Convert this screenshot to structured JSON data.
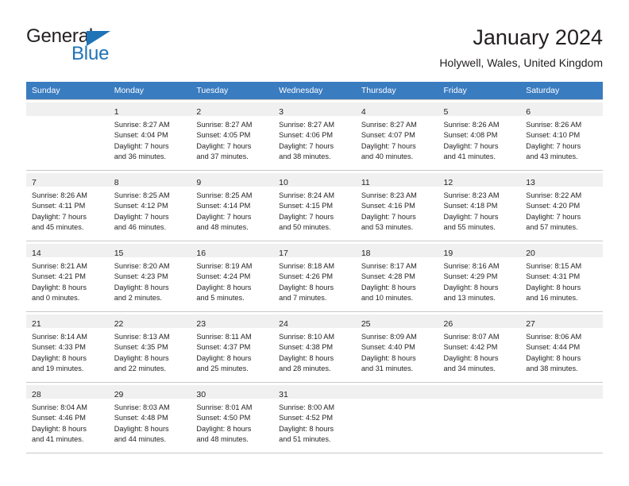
{
  "logo": {
    "word_one": "General",
    "word_two": "Blue",
    "triangle_color": "#1f73b7"
  },
  "header": {
    "title": "January 2024",
    "subtitle": "Holywell, Wales, United Kingdom"
  },
  "theme": {
    "header_bg": "#3a7cc0",
    "daynum_bg": "#f0f0f0",
    "grid_line": "#c8c8c8",
    "text": "#231f20"
  },
  "calendar": {
    "weekday_headers": [
      "Sunday",
      "Monday",
      "Tuesday",
      "Wednesday",
      "Thursday",
      "Friday",
      "Saturday"
    ],
    "weeks": [
      [
        {
          "day": "",
          "lines": []
        },
        {
          "day": "1",
          "lines": [
            "Sunrise: 8:27 AM",
            "Sunset: 4:04 PM",
            "Daylight: 7 hours",
            "and 36 minutes."
          ]
        },
        {
          "day": "2",
          "lines": [
            "Sunrise: 8:27 AM",
            "Sunset: 4:05 PM",
            "Daylight: 7 hours",
            "and 37 minutes."
          ]
        },
        {
          "day": "3",
          "lines": [
            "Sunrise: 8:27 AM",
            "Sunset: 4:06 PM",
            "Daylight: 7 hours",
            "and 38 minutes."
          ]
        },
        {
          "day": "4",
          "lines": [
            "Sunrise: 8:27 AM",
            "Sunset: 4:07 PM",
            "Daylight: 7 hours",
            "and 40 minutes."
          ]
        },
        {
          "day": "5",
          "lines": [
            "Sunrise: 8:26 AM",
            "Sunset: 4:08 PM",
            "Daylight: 7 hours",
            "and 41 minutes."
          ]
        },
        {
          "day": "6",
          "lines": [
            "Sunrise: 8:26 AM",
            "Sunset: 4:10 PM",
            "Daylight: 7 hours",
            "and 43 minutes."
          ]
        }
      ],
      [
        {
          "day": "7",
          "lines": [
            "Sunrise: 8:26 AM",
            "Sunset: 4:11 PM",
            "Daylight: 7 hours",
            "and 45 minutes."
          ]
        },
        {
          "day": "8",
          "lines": [
            "Sunrise: 8:25 AM",
            "Sunset: 4:12 PM",
            "Daylight: 7 hours",
            "and 46 minutes."
          ]
        },
        {
          "day": "9",
          "lines": [
            "Sunrise: 8:25 AM",
            "Sunset: 4:14 PM",
            "Daylight: 7 hours",
            "and 48 minutes."
          ]
        },
        {
          "day": "10",
          "lines": [
            "Sunrise: 8:24 AM",
            "Sunset: 4:15 PM",
            "Daylight: 7 hours",
            "and 50 minutes."
          ]
        },
        {
          "day": "11",
          "lines": [
            "Sunrise: 8:23 AM",
            "Sunset: 4:16 PM",
            "Daylight: 7 hours",
            "and 53 minutes."
          ]
        },
        {
          "day": "12",
          "lines": [
            "Sunrise: 8:23 AM",
            "Sunset: 4:18 PM",
            "Daylight: 7 hours",
            "and 55 minutes."
          ]
        },
        {
          "day": "13",
          "lines": [
            "Sunrise: 8:22 AM",
            "Sunset: 4:20 PM",
            "Daylight: 7 hours",
            "and 57 minutes."
          ]
        }
      ],
      [
        {
          "day": "14",
          "lines": [
            "Sunrise: 8:21 AM",
            "Sunset: 4:21 PM",
            "Daylight: 8 hours",
            "and 0 minutes."
          ]
        },
        {
          "day": "15",
          "lines": [
            "Sunrise: 8:20 AM",
            "Sunset: 4:23 PM",
            "Daylight: 8 hours",
            "and 2 minutes."
          ]
        },
        {
          "day": "16",
          "lines": [
            "Sunrise: 8:19 AM",
            "Sunset: 4:24 PM",
            "Daylight: 8 hours",
            "and 5 minutes."
          ]
        },
        {
          "day": "17",
          "lines": [
            "Sunrise: 8:18 AM",
            "Sunset: 4:26 PM",
            "Daylight: 8 hours",
            "and 7 minutes."
          ]
        },
        {
          "day": "18",
          "lines": [
            "Sunrise: 8:17 AM",
            "Sunset: 4:28 PM",
            "Daylight: 8 hours",
            "and 10 minutes."
          ]
        },
        {
          "day": "19",
          "lines": [
            "Sunrise: 8:16 AM",
            "Sunset: 4:29 PM",
            "Daylight: 8 hours",
            "and 13 minutes."
          ]
        },
        {
          "day": "20",
          "lines": [
            "Sunrise: 8:15 AM",
            "Sunset: 4:31 PM",
            "Daylight: 8 hours",
            "and 16 minutes."
          ]
        }
      ],
      [
        {
          "day": "21",
          "lines": [
            "Sunrise: 8:14 AM",
            "Sunset: 4:33 PM",
            "Daylight: 8 hours",
            "and 19 minutes."
          ]
        },
        {
          "day": "22",
          "lines": [
            "Sunrise: 8:13 AM",
            "Sunset: 4:35 PM",
            "Daylight: 8 hours",
            "and 22 minutes."
          ]
        },
        {
          "day": "23",
          "lines": [
            "Sunrise: 8:11 AM",
            "Sunset: 4:37 PM",
            "Daylight: 8 hours",
            "and 25 minutes."
          ]
        },
        {
          "day": "24",
          "lines": [
            "Sunrise: 8:10 AM",
            "Sunset: 4:38 PM",
            "Daylight: 8 hours",
            "and 28 minutes."
          ]
        },
        {
          "day": "25",
          "lines": [
            "Sunrise: 8:09 AM",
            "Sunset: 4:40 PM",
            "Daylight: 8 hours",
            "and 31 minutes."
          ]
        },
        {
          "day": "26",
          "lines": [
            "Sunrise: 8:07 AM",
            "Sunset: 4:42 PM",
            "Daylight: 8 hours",
            "and 34 minutes."
          ]
        },
        {
          "day": "27",
          "lines": [
            "Sunrise: 8:06 AM",
            "Sunset: 4:44 PM",
            "Daylight: 8 hours",
            "and 38 minutes."
          ]
        }
      ],
      [
        {
          "day": "28",
          "lines": [
            "Sunrise: 8:04 AM",
            "Sunset: 4:46 PM",
            "Daylight: 8 hours",
            "and 41 minutes."
          ]
        },
        {
          "day": "29",
          "lines": [
            "Sunrise: 8:03 AM",
            "Sunset: 4:48 PM",
            "Daylight: 8 hours",
            "and 44 minutes."
          ]
        },
        {
          "day": "30",
          "lines": [
            "Sunrise: 8:01 AM",
            "Sunset: 4:50 PM",
            "Daylight: 8 hours",
            "and 48 minutes."
          ]
        },
        {
          "day": "31",
          "lines": [
            "Sunrise: 8:00 AM",
            "Sunset: 4:52 PM",
            "Daylight: 8 hours",
            "and 51 minutes."
          ]
        },
        {
          "day": "",
          "lines": []
        },
        {
          "day": "",
          "lines": []
        },
        {
          "day": "",
          "lines": []
        }
      ]
    ]
  }
}
